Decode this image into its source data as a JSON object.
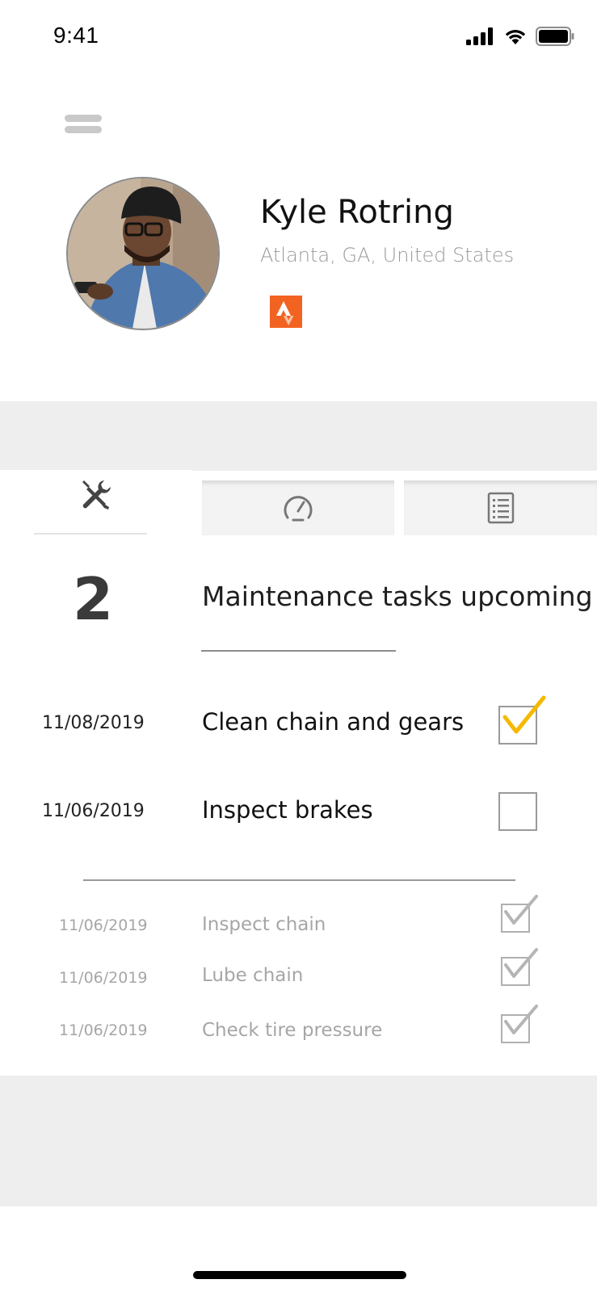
{
  "status_bar": {
    "time": "9:41",
    "icons": [
      "signal-icon",
      "wifi-icon",
      "battery-icon"
    ]
  },
  "header": {
    "menu_icon": "menu-icon"
  },
  "profile": {
    "name": "Kyle Rotring",
    "location": "Atlanta, GA, United States",
    "badge_icon": "strava-icon",
    "badge_color": "#f26322"
  },
  "tabs": [
    {
      "icon": "tools-icon",
      "active": true
    },
    {
      "icon": "speedometer-icon",
      "active": false
    },
    {
      "icon": "list-icon",
      "active": false
    }
  ],
  "summary": {
    "count": "2",
    "label": "Maintenance tasks upcoming"
  },
  "upcoming_tasks": [
    {
      "date": "11/08/2019",
      "title": "Clean chain and gears",
      "checked": true
    },
    {
      "date": "11/06/2019",
      "title": "Inspect brakes",
      "checked": false
    }
  ],
  "completed_tasks": [
    {
      "date": "11/06/2019",
      "title": "Inspect chain",
      "checked": true
    },
    {
      "date": "11/06/2019",
      "title": "Lube chain",
      "checked": true
    },
    {
      "date": "11/06/2019",
      "title": "Check tire pressure",
      "checked": true
    }
  ],
  "colors": {
    "check_active": "#f5b800",
    "check_done": "#b5b5b5",
    "band": "#eeeeee"
  }
}
